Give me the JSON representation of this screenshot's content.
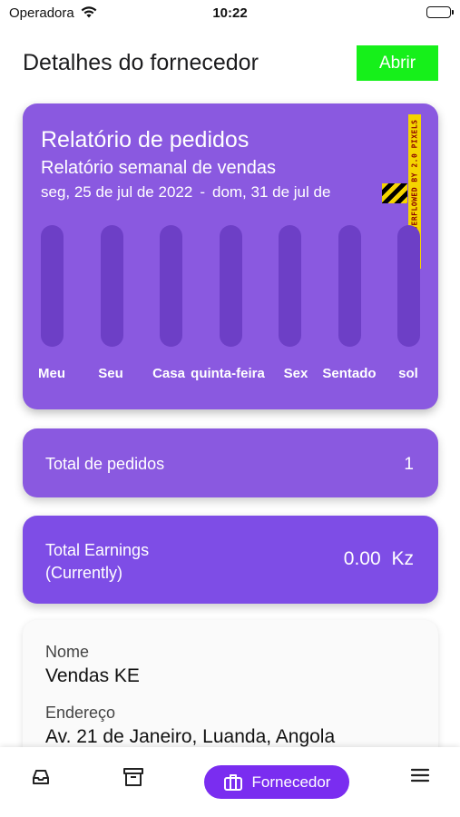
{
  "status_bar": {
    "carrier": "Operadora",
    "time": "10:22"
  },
  "header": {
    "title": "Detalhes do fornecedor",
    "open_button": "Abrir"
  },
  "report": {
    "title": "Relatório de pedidos",
    "subtitle": "Relatório semanal de vendas",
    "date_start": "seg, 25 de jul de 2022",
    "date_separator": "-",
    "date_end": "dom, 31 de jul de",
    "overflow_warning": "RIGHT OVERFLOWED BY 2.0 PIXELS"
  },
  "chart_data": {
    "type": "bar",
    "categories": [
      "Meu",
      "Seu",
      "Casa",
      "quinta-feira",
      "Sex",
      "Sentado",
      "sol"
    ],
    "values": [
      0,
      0,
      0,
      0,
      0,
      0,
      0
    ],
    "title": "",
    "xlabel": "",
    "ylabel": ""
  },
  "total_orders": {
    "label": "Total de pedidos",
    "value": "1"
  },
  "total_earnings": {
    "label_line1": "Total Earnings",
    "label_line2": "(Currently)",
    "value": "0.00 Kz"
  },
  "vendor": {
    "name_label": "Nome",
    "name_value": "Vendas KE",
    "address_label": "Endereço",
    "address_value": "Av. 21 de Janeiro, Luanda, Angola"
  },
  "bottom_nav": {
    "items": [
      {
        "icon": "inbox-icon"
      },
      {
        "icon": "archive-icon"
      },
      {
        "icon": "briefcase-icon",
        "label": "Fornecedor",
        "active": true
      },
      {
        "icon": "menu-icon"
      }
    ]
  },
  "colors": {
    "card_purple": "#8a59e0",
    "bar_track": "#6d3fc6",
    "active_nav": "#7a2df0",
    "open_button": "#16f01a"
  }
}
